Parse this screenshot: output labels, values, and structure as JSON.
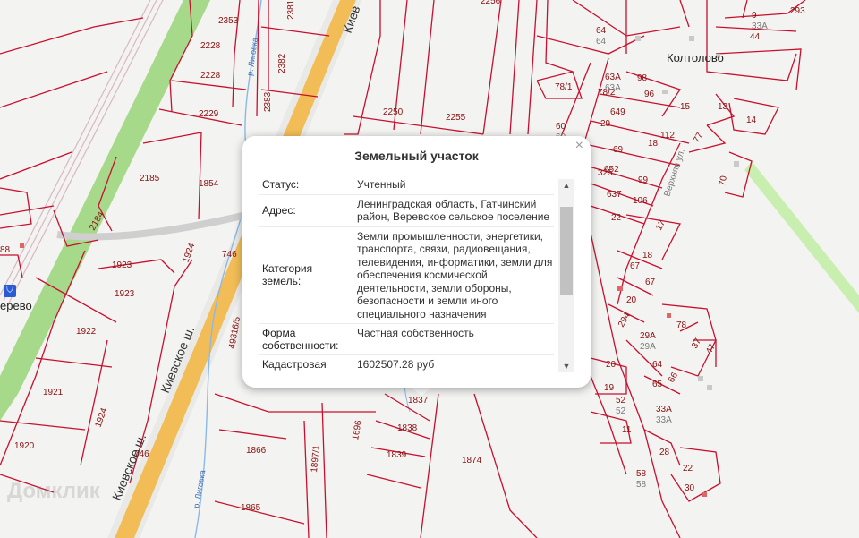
{
  "map": {
    "plot_labels": [
      "2353",
      "2381",
      "2256",
      "2382",
      "2228",
      "2383",
      "2250",
      "2255",
      "2229",
      "2185",
      "1854",
      "2184",
      "746",
      "1923",
      "1924",
      "1923",
      "88",
      "1922",
      "49316/5",
      "1921",
      "1924",
      "1920",
      "746",
      "1866",
      "1897/1",
      "1696",
      "1837",
      "1838",
      "1839",
      "1874",
      "1865",
      "2228",
      "64",
      "9",
      "293",
      "44",
      "63А",
      "98",
      "78/1",
      "78/2",
      "96",
      "15",
      "13",
      "14",
      "60",
      "649",
      "112",
      "29",
      "18",
      "77",
      "69",
      "652",
      "325",
      "99",
      "70",
      "637",
      "106",
      "22",
      "17",
      "18",
      "67",
      "67",
      "20",
      "78",
      "294",
      "37",
      "47",
      "29А",
      "20",
      "64",
      "19",
      "65",
      "66",
      "52",
      "33А",
      "11",
      "28",
      "22",
      "58",
      "30",
      "1"
    ],
    "grey_labels": [
      "64",
      "63А",
      "60",
      "29А",
      "52",
      "33А",
      "58",
      "33А"
    ],
    "roads": [
      "Киевское ш.",
      "Киевское ш.",
      "Киев"
    ],
    "rivers": [
      "р. Лиговка",
      "р. Лиговка"
    ],
    "places": [
      "Колтолово",
      "ерево"
    ],
    "streets": [
      "Верхняя ул."
    ],
    "watermark": "Домклик"
  },
  "popup": {
    "title": "Земельный участок",
    "close_icon": "×",
    "rows": [
      {
        "key": "Статус:",
        "value": "Учтенный"
      },
      {
        "key": "Адрес:",
        "value": "Ленинградская область, Гатчинский район, Веревское сельское поселение"
      },
      {
        "key": "Категория земель:",
        "value": "Земли промышленности, энергетики, транспорта, связи, радиовещания, телевидения, информатики, земли для обеспечения космической деятельности, земли обороны, безопасности и земли иного специального назначения"
      },
      {
        "key": "Форма собственности:",
        "value": "Частная собственность"
      },
      {
        "key": "Кадастровая стоимость:",
        "value": "1602507.28 руб"
      }
    ],
    "scroll_up_icon": "▲",
    "scroll_down_icon": "▼"
  },
  "colors": {
    "plot_border": "#c8102e",
    "railway_green": "#9ed27c",
    "road_orange": "#f2b84b",
    "river_blue": "#7fb2e5"
  }
}
